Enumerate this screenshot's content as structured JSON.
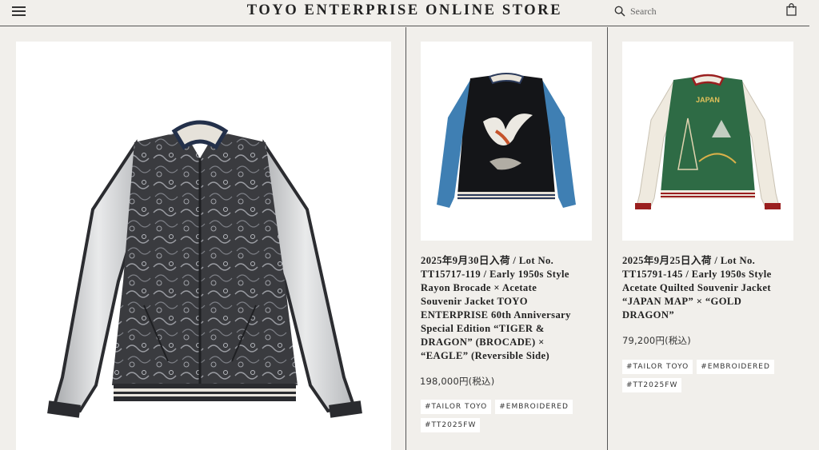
{
  "header": {
    "title": "TOYO ENTERPRISE ONLINE STORE",
    "search_placeholder": "Search"
  },
  "products": [
    {
      "title": "2025年9月30日入荷 / Lot No. TT15717-119 / Early 1950s Style Rayon Brocade × Acetate Souvenir Jacket TOYO ENTERPRISE 60th Anniversary Special Edition “TIGER & DRAGON” (BROCADE) × “EAGLE” (Reversible Side)",
      "title_lines": [
        "2025年9月30日入荷 / Lot No.",
        "TT15717-119 / Early 1950s Style",
        "Rayon Brocade × Acetate",
        "Souvenir Jacket TOYO",
        "ENTERPRISE 60th Anniversary",
        "Special Edition “TIGER &",
        "DRAGON” (BROCADE) ×",
        "“EAGLE” (Reversible Side)"
      ],
      "price": "198,000円(税込)",
      "tags": [
        "#TAILOR TOYO",
        "#EMBROIDERED",
        "#TT2025FW"
      ]
    },
    {
      "title": "2025年9月25日入荷 / Lot No. TT15791-145 / Early 1950s Style Acetate Quilted Souvenir Jacket “JAPAN MAP” × “GOLD DRAGON”",
      "title_lines": [
        "2025年9月25日入荷 / Lot No.",
        "TT15791-145 / Early 1950s Style",
        "Acetate Quilted Souvenir Jacket",
        "“JAPAN MAP” × “GOLD",
        "DRAGON”"
      ],
      "price": "79,200円(税込)",
      "tags": [
        "#TAILOR TOYO",
        "#EMBROIDERED",
        "#TT2025FW"
      ],
      "embroidery_text": "JAPAN"
    }
  ],
  "colors": {
    "background": "#f1efeb",
    "divider": "#555555",
    "text": "#222222",
    "tag_bg": "#ffffff",
    "jacket1_sleeve": "#3f7fb3",
    "jacket2_body": "#2e6b45"
  },
  "icons": {
    "menu": "hamburger-menu-icon",
    "search": "magnifier-icon",
    "cart": "shopping-bag-icon"
  }
}
